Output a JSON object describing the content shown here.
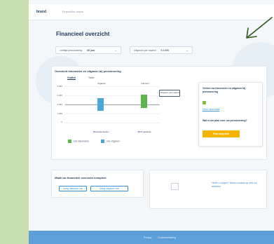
{
  "header": {
    "logo": "brand",
    "nav_link": "Financiële zaken"
  },
  "page_title": "Financieel overzicht",
  "filters": [
    {
      "label": "Leeftijd pensionering",
      "value": "68 jaar"
    },
    {
      "label": "Uitgaven per maand",
      "value": "€ 2.000"
    }
  ],
  "chart_card": {
    "title": "Overzicht inkomsten en uitgaven bij pensionering",
    "tabs": [
      "Grafiek",
      "Tabel"
    ],
    "tooltip": "Uitgaven per maand"
  },
  "chart_data": {
    "type": "bar",
    "ytick_labels": [
      "4.000",
      "3.000",
      "2.000",
      "1.000",
      "0"
    ],
    "ylim": [
      0,
      4000
    ],
    "reference_line": 2000,
    "categories": [
      "Werkzaamheden",
      "Bezit gestelde"
    ],
    "bar_top_labels": [
      "Uitgaven",
      "Inkomen"
    ],
    "bars": [
      {
        "low": 1300,
        "high": 2700,
        "color": "#4aa8d8"
      },
      {
        "low": 1600,
        "high": 3100,
        "color": "#5bb547"
      }
    ]
  },
  "legend": [
    {
      "label": "Uw inkomsten",
      "color": "#5bb547"
    },
    {
      "label": "Uw uitgaven",
      "color": "#4aa8d8"
    }
  ],
  "side_card": {
    "text1": "Verken uw inkomsten en uitgaven bij pensionering",
    "link": "Meer informatie",
    "text2": "Wat is uw plan voor uw pensionering?",
    "button": "Plan afspraak"
  },
  "bottom_card": {
    "title": "Maak uw financieel overzicht compleet",
    "button1": "Voeg inkomen toe",
    "button2": "Voeg uitgaven toe"
  },
  "info_card": {
    "text": "Heeft u vragen? Neem contact op met uw adviseur"
  },
  "footer": {
    "links": [
      "Privacy",
      "Cookieverklaring"
    ]
  }
}
